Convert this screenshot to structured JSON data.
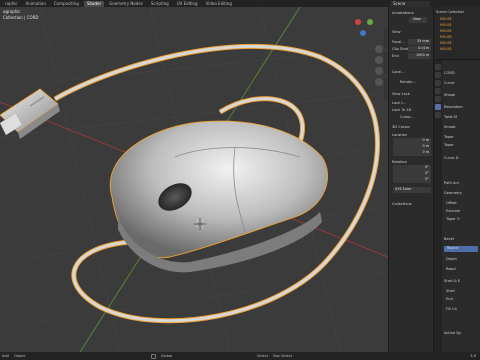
{
  "topbar": {
    "tabs": [
      "raphic",
      "Animation",
      "Compositing",
      "Shader",
      "Geometry Nodes",
      "Scripting",
      "UV Editing",
      "Video Editing"
    ],
    "active_index": 3,
    "scene": "Scene"
  },
  "viewport": {
    "view_label": "ographic",
    "collection_label": "Collection | CORD"
  },
  "npanel": {
    "annotations_header": "Annotations",
    "new_label": "New",
    "view_header": "View",
    "focal_length_label": "Focal...",
    "focal_length_value": "35 mm",
    "clip_start_label": "Clip Start",
    "clip_start_value": "0.01m",
    "clip_end_label": "End",
    "clip_end_value": "1000 m",
    "local_camera_label": "Local...",
    "render_region_label": "Render...",
    "view_lock_header": "View Lock",
    "lock_to_object_label": "Lock t...",
    "lock_label": "Lock",
    "to_3d_label": "To 3D",
    "cursor_label": "Curso...",
    "cursor3d_header": "3D Cursor",
    "location_label": "Location",
    "loc_x": "0 m",
    "loc_y": "0 m",
    "loc_z": "0 m",
    "rotation_label": "Rotation",
    "rot_x": "0°",
    "rot_y": "0°",
    "rot_z": "0°",
    "rot_mode": "XYZ Euler",
    "collections_header": "Collections"
  },
  "outliner": {
    "title": "Scene Collection",
    "items": [
      "MOUSE",
      "MOUSE",
      "MOUSE",
      "MOUSE",
      "MOUSE",
      "MOUSE"
    ]
  },
  "properties": {
    "object_name": "CORD",
    "curve_label": "Curve",
    "rows": [
      "Shape",
      "Resolution",
      "Twist M",
      "Smoot",
      "Taper",
      "Taper",
      "Curve D",
      "Path Ani",
      "Geometry",
      "Offset",
      "Extrude",
      "Taper O",
      "Bevel",
      "Round",
      "Depth",
      "Resol",
      "Start & E",
      "Start",
      "End",
      "Fill Ca",
      "Active Sp"
    ]
  },
  "statusbar": {
    "items": [
      "Add",
      "Object",
      "Global",
      "Select",
      "Box Select"
    ],
    "version": "3.6"
  },
  "colors": {
    "viewport_bg": "#3b3b3b",
    "selection_orange": "#f0a032",
    "axis_red": "#9c3b3b",
    "axis_green": "#5a8a2e"
  }
}
